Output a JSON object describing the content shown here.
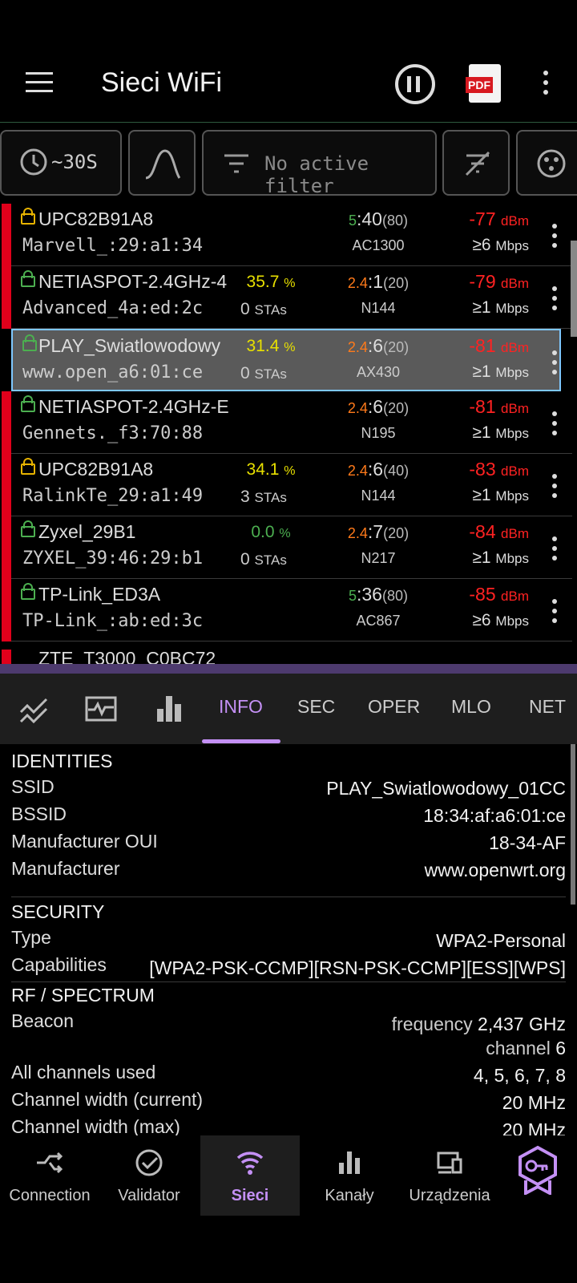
{
  "appbar": {
    "title": "Sieci WiFi",
    "pdf_label": "PDF"
  },
  "toolbar": {
    "timer_label": "~30S",
    "filter_label": "No active filter"
  },
  "networks": [
    {
      "ssid": "UPC82B91A8",
      "mac": "Marvell_:29:a1:34",
      "pct": "",
      "pct_unit": "",
      "stas": "",
      "stas_unit": "",
      "band": "5",
      "channel": ":40",
      "width": "(80)",
      "std": "AC1300",
      "dbm": "-77",
      "dbm_unit": "dBm",
      "mbps": "≥6",
      "mbps_unit": "Mbps",
      "lock_color": "#e8b400",
      "band_color": "#4caf50"
    },
    {
      "ssid": "NETIASPOT-2.4GHz-4",
      "mac": "Advanced_4a:ed:2c",
      "pct": "35.7",
      "pct_unit": "%",
      "stas": "0",
      "stas_unit": "STAs",
      "band": "2.4",
      "channel": ":1",
      "width": "(20)",
      "std": "N144",
      "dbm": "-79",
      "dbm_unit": "dBm",
      "mbps": "≥1",
      "mbps_unit": "Mbps",
      "lock_color": "#4caf50",
      "band_color": "#ff7a1a",
      "pct_color": "#e8e000"
    },
    {
      "ssid": "PLAY_Swiatlowodowy",
      "mac": "www.open_a6:01:ce",
      "pct": "31.4",
      "pct_unit": "%",
      "stas": "0",
      "stas_unit": "STAs",
      "band": "2.4",
      "channel": ":6",
      "width": "(20)",
      "std": "AX430",
      "dbm": "-81",
      "dbm_unit": "dBm",
      "mbps": "≥1",
      "mbps_unit": "Mbps",
      "lock_color": "#4caf50",
      "band_color": "#ff7a1a",
      "pct_color": "#e8e000"
    },
    {
      "ssid": "NETIASPOT-2.4GHz-E",
      "mac": "Gennets._f3:70:88",
      "pct": "",
      "pct_unit": "",
      "stas": "",
      "stas_unit": "",
      "band": "2.4",
      "channel": ":6",
      "width": "(20)",
      "std": "N195",
      "dbm": "-81",
      "dbm_unit": "dBm",
      "mbps": "≥1",
      "mbps_unit": "Mbps",
      "lock_color": "#4caf50",
      "band_color": "#ff7a1a"
    },
    {
      "ssid": "UPC82B91A8",
      "mac": "RalinkTe_29:a1:49",
      "pct": "34.1",
      "pct_unit": "%",
      "stas": "3",
      "stas_unit": "STAs",
      "band": "2.4",
      "channel": ":6",
      "width": "(40)",
      "std": "N144",
      "dbm": "-83",
      "dbm_unit": "dBm",
      "mbps": "≥1",
      "mbps_unit": "Mbps",
      "lock_color": "#e8b400",
      "band_color": "#ff7a1a",
      "pct_color": "#e8e000"
    },
    {
      "ssid": "Zyxel_29B1",
      "mac": "ZYXEL_39:46:29:b1",
      "pct": "0.0",
      "pct_unit": "%",
      "stas": "0",
      "stas_unit": "STAs",
      "band": "2.4",
      "channel": ":7",
      "width": "(20)",
      "std": "N217",
      "dbm": "-84",
      "dbm_unit": "dBm",
      "mbps": "≥1",
      "mbps_unit": "Mbps",
      "lock_color": "#4caf50",
      "band_color": "#ff7a1a",
      "pct_color": "#4caf50"
    },
    {
      "ssid": "TP-Link_ED3A",
      "mac": "TP-Link_:ab:ed:3c",
      "pct": "",
      "pct_unit": "",
      "stas": "",
      "stas_unit": "",
      "band": "5",
      "channel": ":36",
      "width": "(80)",
      "std": "AC867",
      "dbm": "-85",
      "dbm_unit": "dBm",
      "mbps": "≥6",
      "mbps_unit": "Mbps",
      "lock_color": "#4caf50",
      "band_color": "#4caf50"
    }
  ],
  "tabs": [
    "INFO",
    "SEC",
    "OPER",
    "MLO",
    "NET"
  ],
  "info": {
    "identities": "IDENTITIES",
    "ssid_k": "SSID",
    "ssid_v": "PLAY_Swiatlowodowy_01CC",
    "bssid_k": "BSSID",
    "bssid_v": "18:34:af:a6:01:ce",
    "oui_k": "Manufacturer OUI",
    "oui_v": "18-34-AF",
    "manu_k": "Manufacturer",
    "manu_v": "www.openwrt.org",
    "security": "SECURITY",
    "type_k": "Type",
    "type_v": "WPA2-Personal",
    "cap_k": "Capabilities",
    "cap_v": "[WPA2-PSK-CCMP][RSN-PSK-CCMP][ESS][WPS]",
    "rf": "RF / SPECTRUM",
    "beacon_k": "Beacon",
    "beacon_f_lbl": "frequency",
    "beacon_f_val": "2,437 GHz",
    "beacon_c_lbl": "channel",
    "beacon_c_val": "6",
    "allch_k": "All channels used",
    "allch_v": "4, 5, 6, 7, 8",
    "cw_k": "Channel width (current)",
    "cw_v": "20 MHz",
    "cwm_k": "Channel width (max)",
    "cwm_v": "20 MHz"
  },
  "bottom_nav": [
    "Connection",
    "Validator",
    "Sieci",
    "Kanały",
    "Urządzenia"
  ],
  "colors": {
    "accent": "#c490f5",
    "signal_red": "#ff2222"
  }
}
